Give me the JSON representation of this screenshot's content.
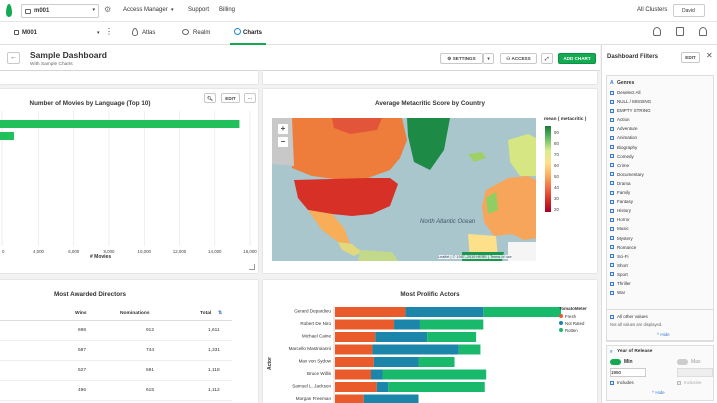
{
  "topnav": {
    "project": "m001",
    "links": [
      "Access Manager",
      "Support",
      "Billing"
    ],
    "all_clusters": "All Clusters",
    "user": "David"
  },
  "subnav": {
    "cluster": "M001",
    "tabs": [
      "Atlas",
      "Realm",
      "Charts"
    ],
    "active_tab": "Charts"
  },
  "dashboard": {
    "title": "Sample Dashboard",
    "subtitle": "With Sample Charts",
    "settings_label": "SETTINGS",
    "access_label": "ACCESS",
    "add_chart_label": "ADD CHART",
    "edit_label": "EDIT"
  },
  "movies_chart": {
    "edit_label": "EDIT",
    "chart_data": {
      "type": "bar",
      "title": "Number of Movies by Language (Top 10)",
      "xlabel": "# Movies",
      "xticks": [
        "0",
        "4,000",
        "6,000",
        "8,000",
        "10,000",
        "12,000",
        "14,000",
        "16,000"
      ],
      "values": [
        15400,
        1000
      ],
      "xlim": [
        2000,
        16000
      ],
      "color": "#21c05a"
    }
  },
  "map_chart": {
    "title": "Average Metacritic Score by Country",
    "legend_title": "mean ( metacritic )",
    "legend_ticks": [
      "90",
      "80",
      "70",
      "60",
      "50",
      "40",
      "30",
      "20"
    ],
    "zoom_in": "+",
    "zoom_out": "−",
    "ocean_label": "North Atlantic Ocean",
    "attribution": "Leaflet | © 1987–2019 HERE | Terms of use"
  },
  "directors_table": {
    "title": "Most Awarded Directors",
    "columns": [
      "Wins",
      "Nominations",
      "Total"
    ],
    "rows": [
      {
        "wins": "698",
        "nominations": "912",
        "total": "1,611"
      },
      {
        "wins": "587",
        "nominations": "744",
        "total": "1,331"
      },
      {
        "wins": "527",
        "nominations": "591",
        "total": "1,118"
      },
      {
        "wins": "496",
        "nominations": "615",
        "total": "1,112"
      }
    ]
  },
  "actors_chart": {
    "chart_data": {
      "type": "bar",
      "title": "Most Prolific Actors",
      "ylabel": "Actor",
      "legend_title": "TomatoMeter",
      "categories": [
        "Gerard Depardieu",
        "Robert De Niro",
        "Michael Caine",
        "Marcello Mastroianni",
        "Max von Sydow",
        "Bruce Willis",
        "Samuel L. Jackson",
        "Morgan Freeman"
      ],
      "series": [
        {
          "name": "Fresh",
          "color": "#ea5b2c",
          "values": [
            49,
            41,
            28,
            26,
            27,
            25,
            29,
            20
          ]
        },
        {
          "name": "Not Rated",
          "color": "#1b86a9",
          "values": [
            54,
            18,
            36,
            60,
            31,
            8,
            8,
            38
          ]
        },
        {
          "name": "Rotten",
          "color": "#19b96b",
          "values": [
            54,
            44,
            34,
            15,
            25,
            72,
            67,
            0
          ]
        }
      ]
    }
  },
  "filters": {
    "title": "Dashboard Filters",
    "edit_label": "EDIT",
    "genres_title": "Genres",
    "deselect_all": "Deselect All",
    "genres": [
      "NULL / MISSING",
      "EMPTY STRING",
      "Action",
      "Adventure",
      "Animation",
      "Biography",
      "Comedy",
      "Crime",
      "Documentary",
      "Drama",
      "Family",
      "Fantasy",
      "History",
      "Horror",
      "Music",
      "Mystery",
      "Romance",
      "Sci-Fi",
      "Short",
      "Sport",
      "Thriller",
      "War"
    ],
    "hide_label": "Hide",
    "add_value": "Add value",
    "all_other_values": "All other values",
    "not_displayed": "Not all values are displayed.",
    "year_title": "Year of Release",
    "min_label": "Min",
    "max_label": "Max",
    "min_value": "1950",
    "includes_label": "Includes",
    "inclusive_label": "Inclusive",
    "hide_label_2": "Hide"
  }
}
